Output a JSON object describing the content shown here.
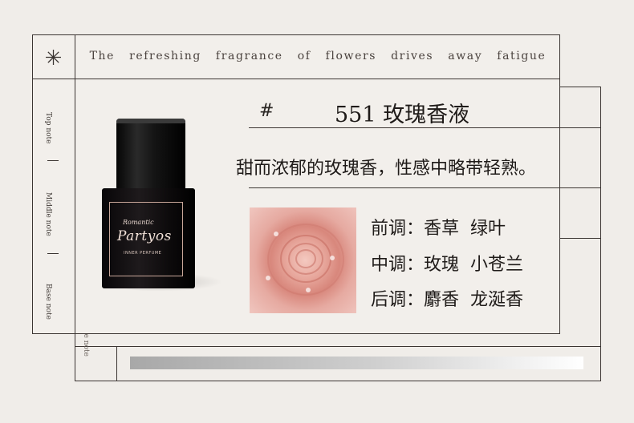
{
  "header": {
    "symbol_icon": "asterisk-icon",
    "tagline": "The refreshing fragrance of flowers drives away fatigue"
  },
  "side_notes": {
    "top": "Top note",
    "middle": "Middle note",
    "base": "Base note",
    "back_card_label": "Base note"
  },
  "product": {
    "hash": "#",
    "title": "551 玫瑰香液",
    "description": "甜而浓郁的玫瑰香，性感中略带轻熟。"
  },
  "bottle_label": {
    "line1": "Romantic",
    "line2": "Partyos",
    "line3": "INNER PERFUME"
  },
  "notes": [
    {
      "label": "前调",
      "value": "香草  绿叶"
    },
    {
      "label": "中调",
      "value": "玫瑰  小苍兰"
    },
    {
      "label": "后调",
      "value": "麝香  龙涎香"
    }
  ],
  "colors": {
    "background": "#f0ede9",
    "line": "#3b3532",
    "rose": "#e6aaa1"
  }
}
